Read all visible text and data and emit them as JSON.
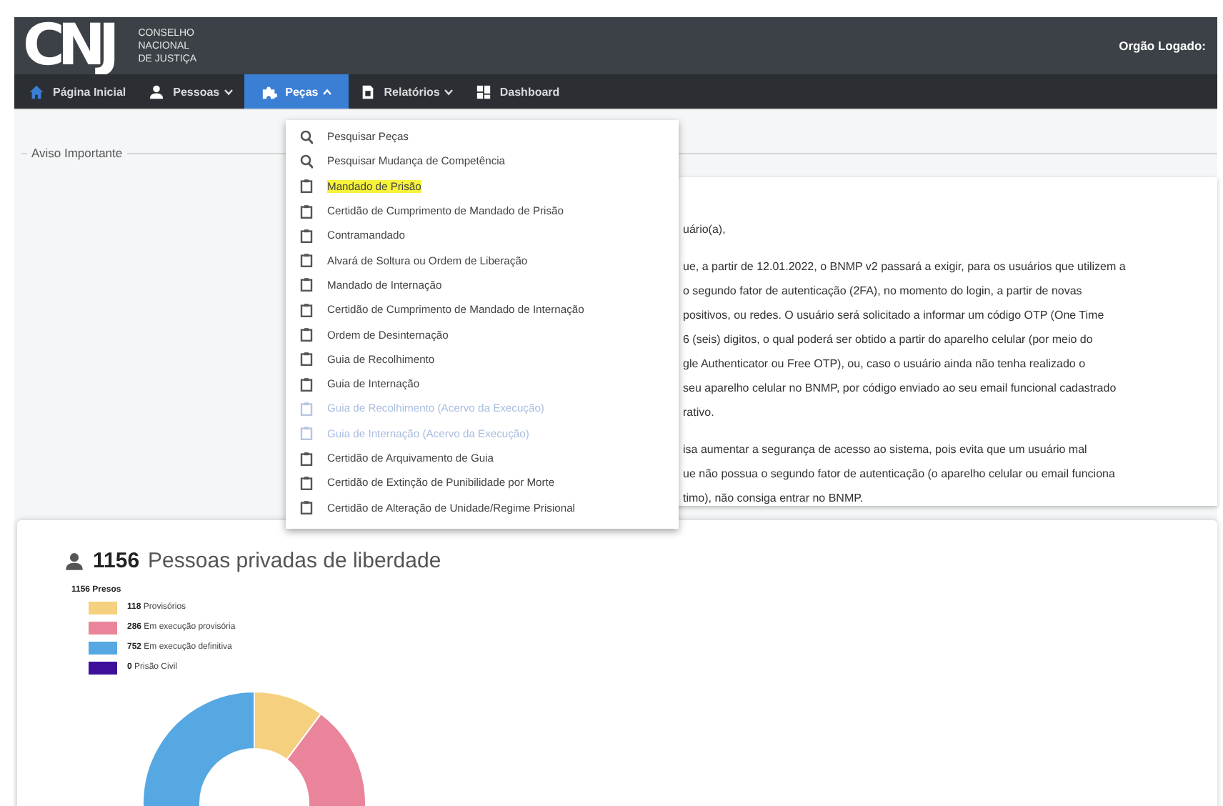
{
  "header": {
    "logo": "CNJ",
    "logo_caption": [
      "CONSELHO",
      "NACIONAL",
      "DE JUSTIÇA"
    ],
    "user_label": "Orgão Logado:"
  },
  "nav": {
    "items": [
      {
        "label": "Página Inicial",
        "kind": "link",
        "selected": false
      },
      {
        "label": "Pessoas",
        "kind": "dropdown",
        "expanded": false,
        "selected": false
      },
      {
        "label": "Peças",
        "kind": "dropdown",
        "expanded": true,
        "selected": true
      },
      {
        "label": "Relatórios",
        "kind": "dropdown",
        "expanded": false,
        "selected": false
      },
      {
        "label": "Dashboard",
        "kind": "link",
        "selected": false
      }
    ]
  },
  "menu": {
    "items": [
      {
        "label": "Pesquisar Peças",
        "kind": "search",
        "highlighted": false,
        "disabled": false
      },
      {
        "label": "Pesquisar Mudança de Competência",
        "kind": "search",
        "highlighted": false,
        "disabled": false
      },
      {
        "label": "Mandado de Prisão",
        "kind": "document",
        "highlighted": true,
        "disabled": false
      },
      {
        "label": "Certidão de Cumprimento de Mandado de Prisão",
        "kind": "document",
        "highlighted": false,
        "disabled": false
      },
      {
        "label": "Contramandado",
        "kind": "document",
        "highlighted": false,
        "disabled": false
      },
      {
        "label": "Alvará de Soltura ou Ordem de Liberação",
        "kind": "document",
        "highlighted": false,
        "disabled": false
      },
      {
        "label": "Mandado de Internação",
        "kind": "document",
        "highlighted": false,
        "disabled": false
      },
      {
        "label": "Certidão de Cumprimento de Mandado de Internação",
        "kind": "document",
        "highlighted": false,
        "disabled": false
      },
      {
        "label": "Ordem de Desinternação",
        "kind": "document",
        "highlighted": false,
        "disabled": false
      },
      {
        "label": "Guia de Recolhimento",
        "kind": "document",
        "highlighted": false,
        "disabled": false
      },
      {
        "label": "Guia de Internação",
        "kind": "document",
        "highlighted": false,
        "disabled": false
      },
      {
        "label": "Guia de Recolhimento (Acervo da Execução)",
        "kind": "document",
        "highlighted": false,
        "disabled": true
      },
      {
        "label": "Guia de Internação (Acervo da Execução)",
        "kind": "document",
        "highlighted": false,
        "disabled": true
      },
      {
        "label": "Certidão de Arquivamento de Guia",
        "kind": "document",
        "highlighted": false,
        "disabled": false
      },
      {
        "label": "Certidão de Extinção de Punibilidade por Morte",
        "kind": "document",
        "highlighted": false,
        "disabled": false
      },
      {
        "label": "Certidão de Alteração de Unidade/Regime Prisional",
        "kind": "document",
        "highlighted": false,
        "disabled": false
      }
    ]
  },
  "notice": {
    "title": "Aviso Importante",
    "paragraphs": [
      [
        "uário(a),"
      ],
      [
        "ue, a partir de 12.01.2022, o BNMP v2 passará a exigir, para os usuários que utilizem a",
        "o segundo fator de autenticação (2FA), no momento do login, a partir de novas",
        "positivos, ou redes. O usuário será solicitado a informar um código OTP (One Time",
        "6 (seis) digitos, o qual poderá ser obtido a partir do aparelho celular (por meio do",
        "gle Authenticator ou Free OTP), ou, caso o usuário ainda não tenha realizado o",
        "seu aparelho celular no BNMP, por código enviado ao seu email funcional cadastrado",
        "rativo."
      ],
      [
        "isa aumentar a segurança de acesso ao sistema, pois evita que um usuário mal",
        "ue não possua o segundo fator de autenticação (o aparelho celular ou email funciona",
        "timo), não consiga entrar no BNMP."
      ]
    ]
  },
  "stats": {
    "count": "1156",
    "title": "Pessoas privadas de liberdade",
    "legend_title": "1156 Presos",
    "legend": [
      {
        "count": "118",
        "color": "#f5d07e"
      },
      {
        "count": "286",
        "color": "#e9849a"
      },
      {
        "count": "752",
        "color": "#56a8e2"
      },
      {
        "count": "0",
        "color": "#3d0f9a"
      }
    ],
    "chart_data": {
      "type": "donut",
      "categories": [
        "Provisórios",
        "Em execução provisória",
        "Em execução definitiva",
        "Prisão Civil"
      ],
      "values": [
        10.2,
        24.7,
        65.1,
        0
      ]
    }
  }
}
